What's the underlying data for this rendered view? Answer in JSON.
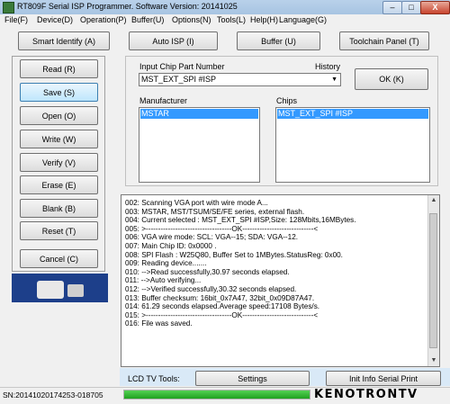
{
  "window": {
    "title": "RT809F Serial ISP Programmer. Software Version: 20141025",
    "min_label": "–",
    "max_label": "□",
    "close_label": "X"
  },
  "menu": [
    "File(F)",
    "Device(D)",
    "Operation(P)",
    "Buffer(U)",
    "Options(N)",
    "Tools(L)",
    "Help(H)",
    "Language(G)"
  ],
  "toolbar": {
    "smart_identify": "Smart Identify (A)",
    "auto_isp": "Auto ISP (I)",
    "buffer": "Buffer (U)",
    "toolchain": "Toolchain Panel (T)"
  },
  "actions": {
    "read": "Read (R)",
    "save": "Save (S)",
    "open": "Open (O)",
    "write": "Write  (W)",
    "verify": "Verify (V)",
    "erase": "Erase (E)",
    "blank": "Blank (B)",
    "reset": "Reset  (T)",
    "cancel": "Cancel (C)"
  },
  "chip": {
    "input_label": "Input Chip Part Number",
    "history_label": "History",
    "part_value": "MST_EXT_SPI #ISP",
    "ok_label": "OK (K)",
    "manufacturer_label": "Manufacturer",
    "chips_label": "Chips",
    "manufacturer_selected": "MSTAR",
    "chip_selected": "MST_EXT_SPI #ISP"
  },
  "log": [
    "002:  Scanning VGA port with wire mode A...",
    "003:  MSTAR, MST/TSUM/SE/FE series, external flash.",
    "004:  Current selected : MST_EXT_SPI #ISP,Size: 128Mbits,16MBytes.",
    "005:  >-----------------------------------OK-----------------------------<",
    "006:  VGA wire mode: SCL: VGA--15; SDA: VGA--12.",
    "007:  Main Chip ID: 0x0000 .",
    "008:  SPI Flash : W25Q80, Buffer Set to 1MBytes.StatusReg: 0x00.",
    "009:  Reading device.......",
    "010:  -->Read successfully,30.97 seconds elapsed.",
    "011:  -->Auto verifying...",
    "012:  -->Verified successfully,30.32 seconds elapsed.",
    "013:  Buffer checksum: 16bit_0x7A47, 32bit_0x09D87A47.",
    "014:  61.29 seconds elapsed.Average speed:17108 Bytes/s.",
    "015:  >-----------------------------------OK-----------------------------<",
    "016:  File was saved."
  ],
  "bottom": {
    "lcd_label": "LCD TV Tools:",
    "settings": "Settings",
    "init_info": "Init Info Serial Print"
  },
  "status": {
    "sn": "SN:20141020174253-018705",
    "progress": 1.0,
    "logo": "KENOTRONTV"
  }
}
